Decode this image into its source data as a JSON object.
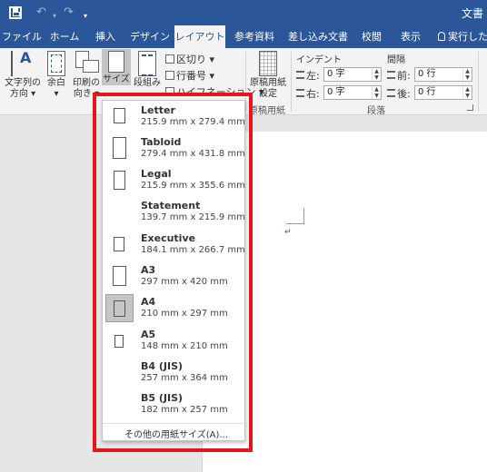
{
  "window": {
    "title": "文書"
  },
  "quick_access": {
    "undo_icon": "undo-icon",
    "redo_icon": "redo-icon"
  },
  "tabs": [
    {
      "label": "ファイル"
    },
    {
      "label": "ホーム"
    },
    {
      "label": "挿入"
    },
    {
      "label": "デザイン"
    },
    {
      "label": "レイアウト"
    },
    {
      "label": "参考資料"
    },
    {
      "label": "差し込み文書"
    },
    {
      "label": "校閲"
    },
    {
      "label": "表示"
    }
  ],
  "tell_me": "実行したい",
  "ribbon": {
    "text_direction": [
      "文字列の",
      "方向 ▾"
    ],
    "margins": [
      "余白",
      "▾"
    ],
    "orientation": [
      "印刷の",
      "向き ▾"
    ],
    "size": "サイズ",
    "columns": "段組み",
    "breaks": "区切り ▾",
    "line_numbers": "行番号 ▾",
    "hyphenation": "ハイフネーション ▾",
    "genko": [
      "原稿用紙",
      "設定"
    ],
    "genko_group": "原稿用紙",
    "indent": {
      "title": "インデント",
      "left_label": "左:",
      "left_value": "0 字",
      "right_label": "右:",
      "right_value": "0 字"
    },
    "spacing": {
      "title": "間隔",
      "before_label": "前:",
      "before_value": "0 行",
      "after_label": "後:",
      "after_value": "0 行"
    },
    "paragraph_group": "段落"
  },
  "document": {
    "paragraph_mark": "↵"
  },
  "size_menu": {
    "items": [
      {
        "name": "Letter",
        "dims": "215.9 mm x 279.4 mm"
      },
      {
        "name": "Tabloid",
        "dims": "279.4 mm x 431.8 mm"
      },
      {
        "name": "Legal",
        "dims": "215.9 mm x 355.6 mm"
      },
      {
        "name": "Statement",
        "dims": "139.7 mm x 215.9 mm"
      },
      {
        "name": "Executive",
        "dims": "184.1 mm x 266.7 mm"
      },
      {
        "name": "A3",
        "dims": "297 mm x 420 mm"
      },
      {
        "name": "A4",
        "dims": "210 mm x 297 mm",
        "selected": true
      },
      {
        "name": "A5",
        "dims": "148 mm x 210 mm"
      },
      {
        "name": "B4 (JIS)",
        "dims": "257 mm x 364 mm"
      },
      {
        "name": "B5 (JIS)",
        "dims": "182 mm x 257 mm"
      }
    ],
    "more": "その他の用紙サイズ(A)...",
    "highlight_color": "#e8141c"
  },
  "colors": {
    "brand": "#2b579a",
    "selection": "#c5c5c5"
  }
}
